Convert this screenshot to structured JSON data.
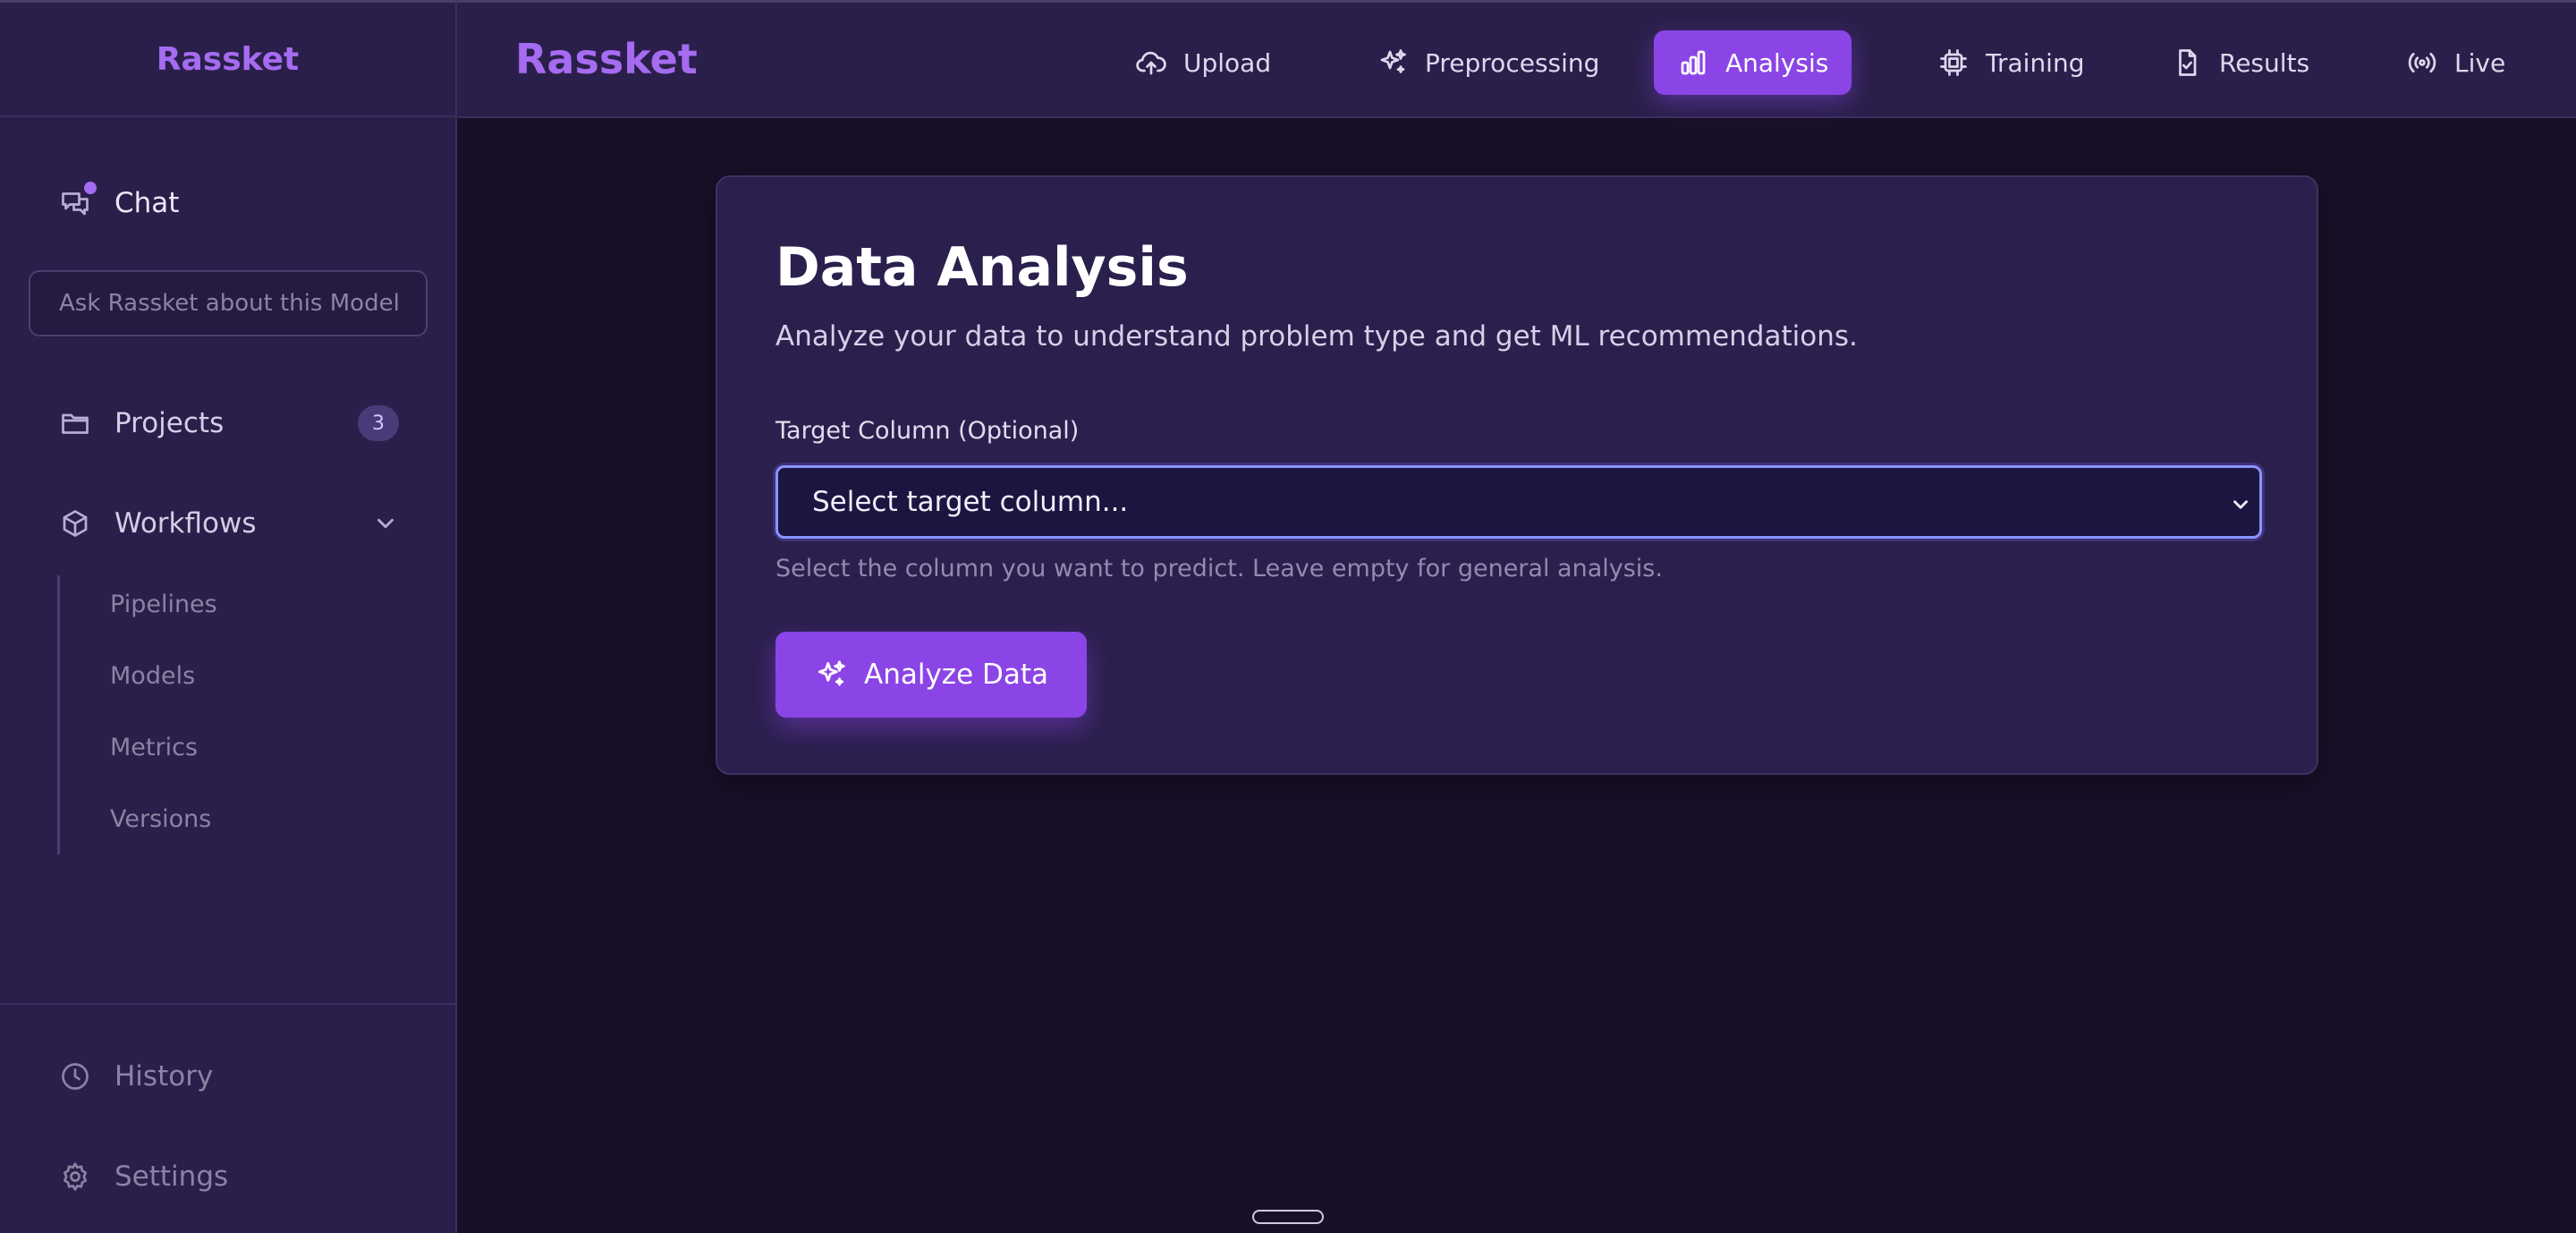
{
  "sidebar": {
    "brand": "Rassket",
    "chat_label": "Chat",
    "search_placeholder": "Ask Rassket about this Model",
    "projects": {
      "label": "Projects",
      "count": "3"
    },
    "workflows": {
      "label": "Workflows",
      "expanded": true,
      "items": [
        "Pipelines",
        "Models",
        "Metrics",
        "Versions"
      ]
    },
    "history_label": "History",
    "settings_label": "Settings"
  },
  "header": {
    "brand": "Rassket",
    "nav": [
      {
        "label": "Upload",
        "icon": "cloud-upload-icon",
        "active": false
      },
      {
        "label": "Preprocessing",
        "icon": "sparkles-icon",
        "active": false
      },
      {
        "label": "Analysis",
        "icon": "bar-chart-icon",
        "active": true
      },
      {
        "label": "Training",
        "icon": "cpu-chip-icon",
        "active": false
      },
      {
        "label": "Results",
        "icon": "file-check-icon",
        "active": false
      },
      {
        "label": "Live",
        "icon": "broadcast-icon",
        "active": false
      }
    ]
  },
  "main": {
    "title": "Data Analysis",
    "subtitle": "Analyze your data to understand problem type and get ML recommendations.",
    "target_column": {
      "label": "Target Column (Optional)",
      "selected": "Select target column...",
      "help": "Select the column you want to predict. Leave empty for general analysis."
    },
    "analyze_button": "Analyze Data"
  },
  "colors": {
    "accent": "#8b45e6",
    "brand": "#a56bf0",
    "background": "#181028",
    "panel": "#2a1f4a"
  }
}
